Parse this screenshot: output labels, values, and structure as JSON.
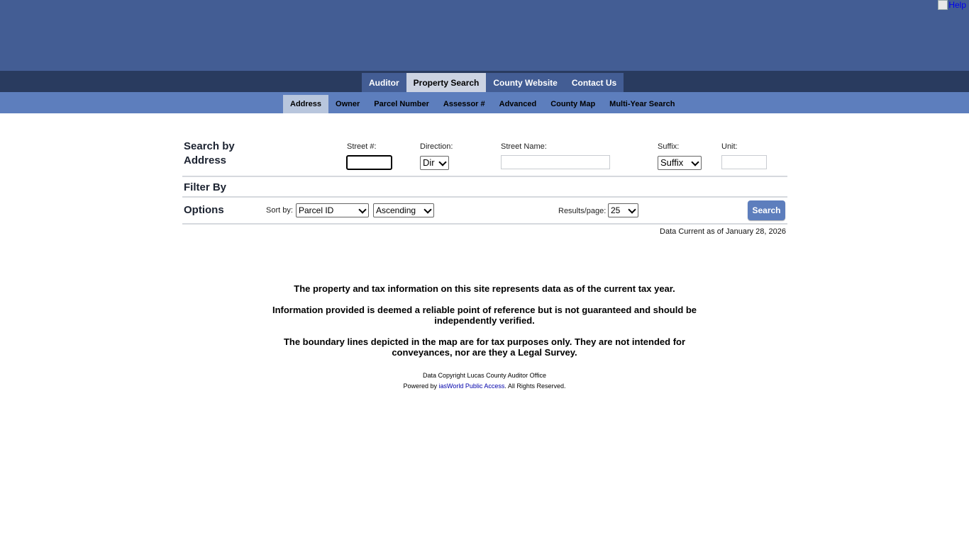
{
  "header": {
    "help_label": "Help"
  },
  "top_nav": {
    "items": [
      "Auditor",
      "Property Search",
      "County Website",
      "Contact Us"
    ],
    "active": "Property Search"
  },
  "sub_nav": {
    "items": [
      "Address",
      "Owner",
      "Parcel Number",
      "Assessor #",
      "Advanced",
      "County Map",
      "Multi-Year Search"
    ],
    "active": "Address"
  },
  "search": {
    "title_line1": "Search by",
    "title_line2": "Address",
    "street_num_label": "Street #:",
    "street_num_value": "",
    "direction_label": "Direction:",
    "direction_value": "Dir",
    "street_name_label": "Street Name:",
    "street_name_value": "",
    "suffix_label": "Suffix:",
    "suffix_value": "Suffix",
    "unit_label": "Unit:",
    "unit_value": ""
  },
  "filter": {
    "title": "Filter By"
  },
  "options": {
    "title": "Options",
    "sort_label": "Sort by:",
    "sort_field": "Parcel ID",
    "sort_order": "Ascending",
    "results_label": "Results/page:",
    "results_value": "25",
    "search_button": "Search"
  },
  "data_current": "Data Current as of January 28, 2026",
  "notice": {
    "p1": "The property and tax information on this site represents data as of the current tax year.",
    "p2": "Information provided is deemed a reliable point of reference but is not guaranteed and should be independently verified.",
    "p3": "The boundary lines depicted in the map are for tax purposes only. They are not intended for conveyances, nor are they a Legal Survey."
  },
  "footer": {
    "copyright": "Data Copyright Lucas County Auditor Office",
    "powered_prefix": "Powered by ",
    "powered_link": "iasWorld Public Access",
    "powered_suffix": ". All Rights Reserved."
  }
}
